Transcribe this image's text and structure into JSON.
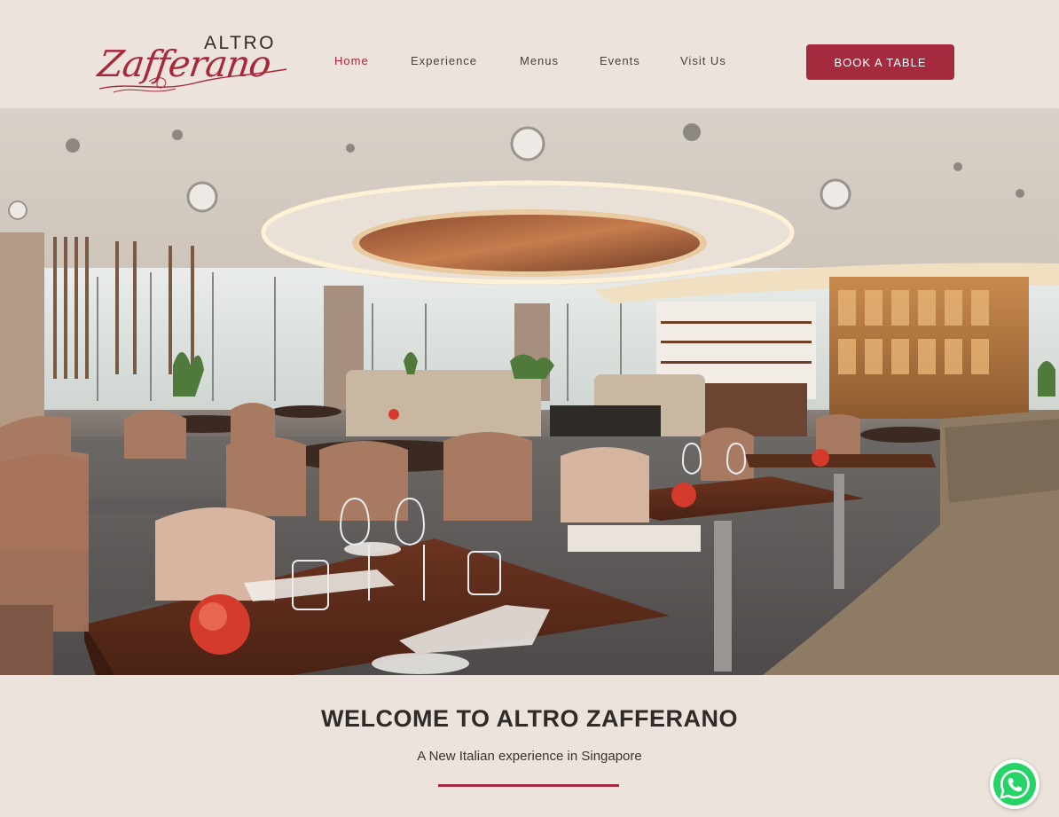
{
  "brand": {
    "name_top": "ALTRO",
    "name_script": "Zafferano",
    "accent_color": "#a52a3e",
    "background_color": "#ece3dc"
  },
  "nav": {
    "items": [
      {
        "label": "Home",
        "active": true
      },
      {
        "label": "Experience",
        "active": false
      },
      {
        "label": "Menus",
        "active": false
      },
      {
        "label": "Events",
        "active": false
      },
      {
        "label": "Visit Us",
        "active": false
      }
    ]
  },
  "cta": {
    "book_label": "BOOK A TABLE"
  },
  "hero": {
    "icon": "restaurant-interior-photo"
  },
  "welcome": {
    "title": "WELCOME TO ALTRO ZAFFERANO",
    "subtitle": "A New Italian experience in Singapore"
  },
  "floating": {
    "icon": "whatsapp-icon",
    "color": "#25d366"
  }
}
